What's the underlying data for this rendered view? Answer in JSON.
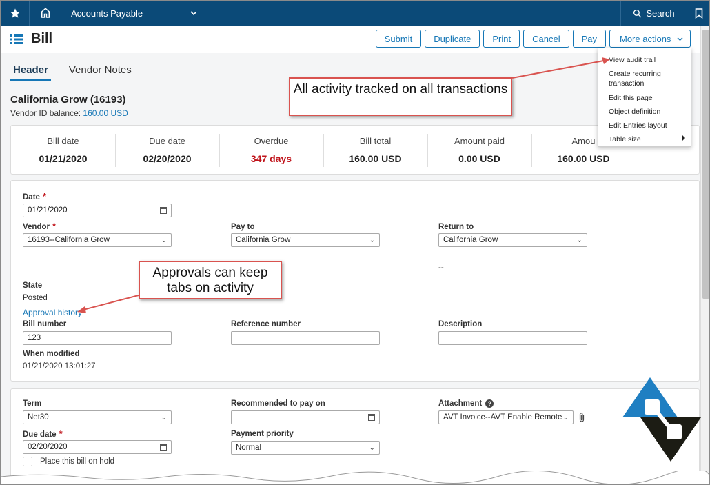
{
  "topbar": {
    "module": "Accounts Payable",
    "search_label": "Search"
  },
  "page": {
    "title": "Bill",
    "actions": [
      "Submit",
      "Duplicate",
      "Print",
      "Cancel",
      "Pay"
    ],
    "more_actions": "More actions"
  },
  "more_menu": {
    "items": [
      "View audit trail",
      "Create recurring",
      "transaction",
      "Edit this page",
      "Object definition",
      "Edit Entries layout",
      "Table size"
    ]
  },
  "tabs": [
    "Header",
    "Vendor Notes"
  ],
  "vendor": {
    "name": "California Grow (16193)",
    "balance_label": "Vendor ID balance:",
    "balance_value": "160.00 USD"
  },
  "summary": [
    {
      "label": "Bill date",
      "value": "01/21/2020"
    },
    {
      "label": "Due date",
      "value": "02/20/2020"
    },
    {
      "label": "Overdue",
      "value": "347 days"
    },
    {
      "label": "Bill total",
      "value": "160.00 USD"
    },
    {
      "label": "Amount paid",
      "value": "0.00 USD"
    },
    {
      "label": "Amou",
      "value": "160.00 USD"
    }
  ],
  "form": {
    "date_label": "Date",
    "date_value": "01/21/2020",
    "vendor_label": "Vendor",
    "vendor_value": "16193--California Grow",
    "pay_to_label": "Pay to",
    "pay_to_value": "California Grow",
    "return_to_label": "Return to",
    "return_to_value": "California Grow",
    "return_to_extra": "--",
    "state_label": "State",
    "state_value": "Posted",
    "approval_history": "Approval history",
    "bill_number_label": "Bill number",
    "bill_number_value": "123",
    "reference_label": "Reference number",
    "description_label": "Description",
    "when_modified_label": "When modified",
    "when_modified_value": "01/21/2020 13:01:27",
    "required_mark": "*"
  },
  "form2": {
    "term_label": "Term",
    "term_value": "Net30",
    "recommended_label": "Recommended to pay on",
    "attachment_label": "Attachment",
    "attachment_value": "AVT Invoice--AVT Enable Remote",
    "due_date_label": "Due date",
    "due_date_value": "02/20/2020",
    "payment_priority_label": "Payment priority",
    "payment_priority_value": "Normal",
    "hold_label": "Place this bill on hold",
    "help_glyph": "?"
  },
  "callouts": {
    "audit": "All activity tracked on all transactions",
    "approvals": "Approvals can keep tabs on activity"
  },
  "colors": {
    "topbar": "#0b4a78",
    "accent": "#1677b6",
    "overdue": "#c0141b",
    "callout_border": "#d9534f",
    "logo_blue": "#1f7fc2",
    "logo_dark": "#1c1c14"
  },
  "icons": {
    "star": "star-icon",
    "home": "home-icon",
    "search": "search-icon",
    "bookmark": "bookmark-icon",
    "list": "list-icon",
    "calendar": "calendar-icon",
    "paperclip": "paperclip-icon",
    "help": "help-icon"
  }
}
